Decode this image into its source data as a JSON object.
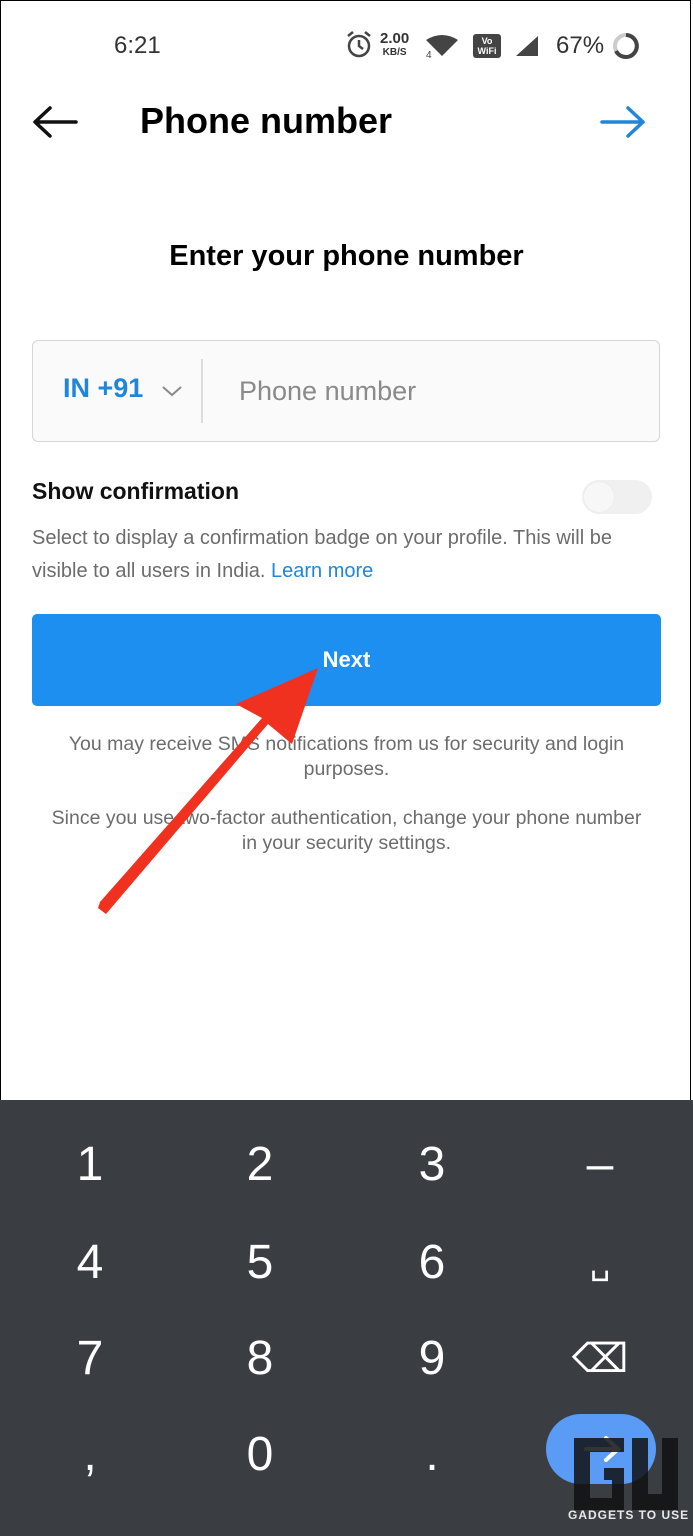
{
  "status_bar": {
    "time": "6:21",
    "net_speed_value": "2.00",
    "net_speed_unit": "KB/S",
    "battery_percent": "67%",
    "icons": [
      "alarm-icon",
      "wifi-4g-icon",
      "vowifi-icon",
      "cell-signal-icon",
      "battery-ring-icon"
    ]
  },
  "header": {
    "title": "Phone number",
    "back_icon": "arrow-left-icon",
    "forward_icon": "arrow-right-icon",
    "forward_color": "#1f86d9"
  },
  "main": {
    "heading": "Enter your phone number",
    "country_code": "IN +91",
    "phone_placeholder": "Phone number",
    "phone_value": "",
    "show_confirmation_label": "Show confirmation",
    "show_confirmation_enabled": false,
    "description_text": "Select to display a confirmation badge on your profile. This will be visible to all users in India.",
    "learn_more": "Learn more",
    "next_label": "Next",
    "info_1": "You may receive SMS notifications from us for security and login purposes.",
    "info_2": "Since you use two-factor authentication, change your phone number in your security settings.",
    "accent_color": "#1d8ff0"
  },
  "keyboard": {
    "keys": [
      "1",
      "2",
      "3",
      "–",
      "4",
      "5",
      "6",
      "␣",
      "7",
      "8",
      "9",
      "⌫",
      ",",
      "0",
      "."
    ],
    "go_icon": "arrow-right-icon"
  },
  "watermark": {
    "text": "GADGETS TO USE"
  }
}
